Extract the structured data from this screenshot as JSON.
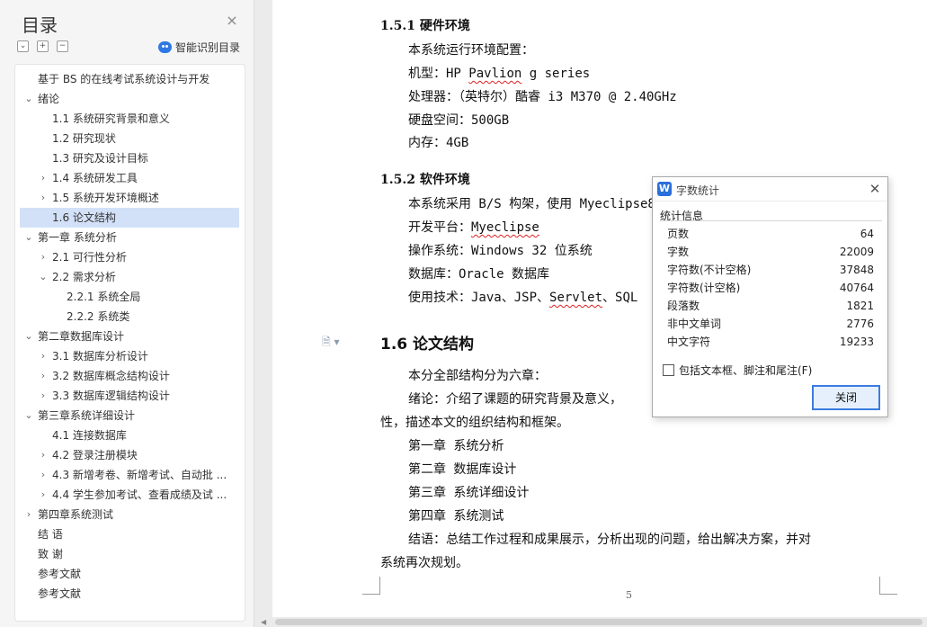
{
  "outline": {
    "title": "目录",
    "smart_label": "智能识别目录",
    "tools": [
      "⌄",
      "+",
      "−"
    ],
    "items": [
      {
        "label": "基于 BS 的在线考试系统设计与开发",
        "toggle": "",
        "selected": false
      },
      {
        "label": "绪论",
        "toggle": "⌄",
        "selected": false
      },
      {
        "label": "1.1 系统研究背景和意义",
        "toggle": "",
        "selected": false
      },
      {
        "label": "1.2 研究现状",
        "toggle": "",
        "selected": false
      },
      {
        "label": "1.3 研究及设计目标",
        "toggle": "",
        "selected": false
      },
      {
        "label": "1.4 系统研发工具",
        "toggle": "›",
        "selected": false
      },
      {
        "label": "1.5 系统开发环境概述",
        "toggle": "›",
        "selected": false
      },
      {
        "label": "1.6  论文结构",
        "toggle": "",
        "selected": true
      },
      {
        "label": "第一章  系统分析",
        "toggle": "⌄",
        "selected": false
      },
      {
        "label": "2.1 可行性分析",
        "toggle": "›",
        "selected": false
      },
      {
        "label": "2.2  需求分析",
        "toggle": "⌄",
        "selected": false
      },
      {
        "label": "2.2.1 系统全局",
        "toggle": "",
        "selected": false
      },
      {
        "label": "2.2.2  系统类",
        "toggle": "",
        "selected": false
      },
      {
        "label": "第二章数据库设计",
        "toggle": "⌄",
        "selected": false
      },
      {
        "label": "3.1 数据库分析设计",
        "toggle": "›",
        "selected": false
      },
      {
        "label": "3.2 数据库概念结构设计",
        "toggle": "›",
        "selected": false
      },
      {
        "label": "3.3 数据库逻辑结构设计",
        "toggle": "›",
        "selected": false
      },
      {
        "label": "第三章系统详细设计",
        "toggle": "⌄",
        "selected": false
      },
      {
        "label": "4.1 连接数据库",
        "toggle": "",
        "selected": false
      },
      {
        "label": "4.2  登录注册模块",
        "toggle": "›",
        "selected": false
      },
      {
        "label": "4.3 新增考卷、新增考试、自动批 ...",
        "toggle": "›",
        "selected": false
      },
      {
        "label": "4.4 学生参加考试、查看成绩及试 ...",
        "toggle": "›",
        "selected": false
      },
      {
        "label": "第四章系统测试",
        "toggle": "›",
        "selected": false
      },
      {
        "label": "结    语",
        "toggle": "",
        "selected": false
      },
      {
        "label": "致    谢",
        "toggle": "",
        "selected": false
      },
      {
        "label": "参考文献",
        "toggle": "",
        "selected": false
      },
      {
        "label": "参考文献",
        "toggle": "",
        "selected": false
      }
    ]
  },
  "doc": {
    "h151": "1.5.1 硬件环境",
    "hw_intro": "本系统运行环境配置：",
    "hw_model_prefix": "机型：HP ",
    "hw_model_word": "Pavlion",
    "hw_model_suffix": " g series",
    "hw_cpu": "处理器：（英特尔）酷睿 i3 M370 @ 2.40GHz",
    "hw_disk": "硬盘空间：500GB",
    "hw_mem": "内存：4GB",
    "h152": "1.5.2 软件环境",
    "sw_intro": "本系统采用 B/S 构架，使用 Myeclipse8",
    "sw_platform_prefix": "开发平台：",
    "sw_platform_word": "Myeclipse",
    "sw_os": "操作系统：Windows 32 位系统",
    "sw_db": "数据库：Oracle 数据库",
    "sw_tech_prefix": "使用技术：Java、JSP、",
    "sw_tech_word": "Servlet",
    "sw_tech_suffix": "、SQL",
    "h16": "1.6  论文结构",
    "p1": "本分全部结构分为六章：",
    "p2": "绪论：介绍了课题的研究背景及意义，",
    "p3": "性，描述本文的组织结构和框架。",
    "ch1": "第一章  系统分析",
    "ch2": "第二章  数据库设计",
    "ch3": "第三章  系统详细设计",
    "ch4": "第四章  系统测试",
    "concl1": "结语：总结工作过程和成果展示，分析出现的问题，给出解决方案，并对",
    "concl2": "系统再次规划。",
    "page_number": "5",
    "para_icon": "🗎 ▾"
  },
  "dialog": {
    "logo": "W",
    "title": "字数统计",
    "section": "统计信息",
    "stats": [
      {
        "label": "页数",
        "value": "64"
      },
      {
        "label": "字数",
        "value": "22009"
      },
      {
        "label": "字符数(不计空格)",
        "value": "37848"
      },
      {
        "label": "字符数(计空格)",
        "value": "40764"
      },
      {
        "label": "段落数",
        "value": "1821"
      },
      {
        "label": "非中文单词",
        "value": "2776"
      },
      {
        "label": "中文字符",
        "value": "19233"
      }
    ],
    "checkbox_label": "包括文本框、脚注和尾注(F)",
    "close_label": "关闭"
  }
}
